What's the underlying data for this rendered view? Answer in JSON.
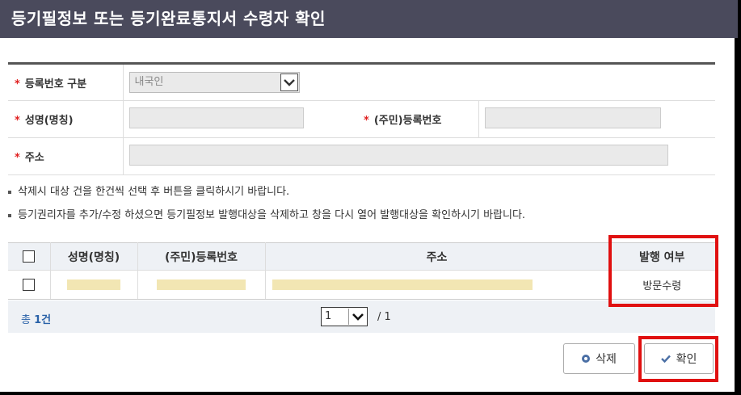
{
  "title": "등기필정보 또는 등기완료통지서 수령자 확인",
  "form": {
    "required_mark": "*",
    "reg_type_label": "등록번호 구분",
    "reg_type_value": "내국인",
    "name_label": "성명(명칭)",
    "id_label": "(주민)등록번호",
    "address_label": "주소"
  },
  "notes": [
    "삭제시 대상 건을 한건씩 선택 후 버튼을 클릭하시기 바랍니다.",
    "등기권리자를 추가/수정 하셨으면 등기필정보 발행대상을 삭제하고 창을 다시 열어 발행대상을 확인하시기 바랍니다."
  ],
  "list": {
    "columns": [
      "성명(명칭)",
      "(주민)등록번호",
      "주소",
      "발행 여부"
    ],
    "rows": [
      {
        "issue_status": "방문수령"
      }
    ]
  },
  "footer": {
    "total_prefix": "총",
    "total_count": "1건",
    "page_current": "1",
    "page_total": "/ 1"
  },
  "buttons": {
    "delete": "삭제",
    "confirm": "확인"
  },
  "colors": {
    "title_bg": "#4a4a5c",
    "highlight_red": "#e01010",
    "masked_fill": "#f2e6b3",
    "total_blue": "#2a62a8"
  }
}
